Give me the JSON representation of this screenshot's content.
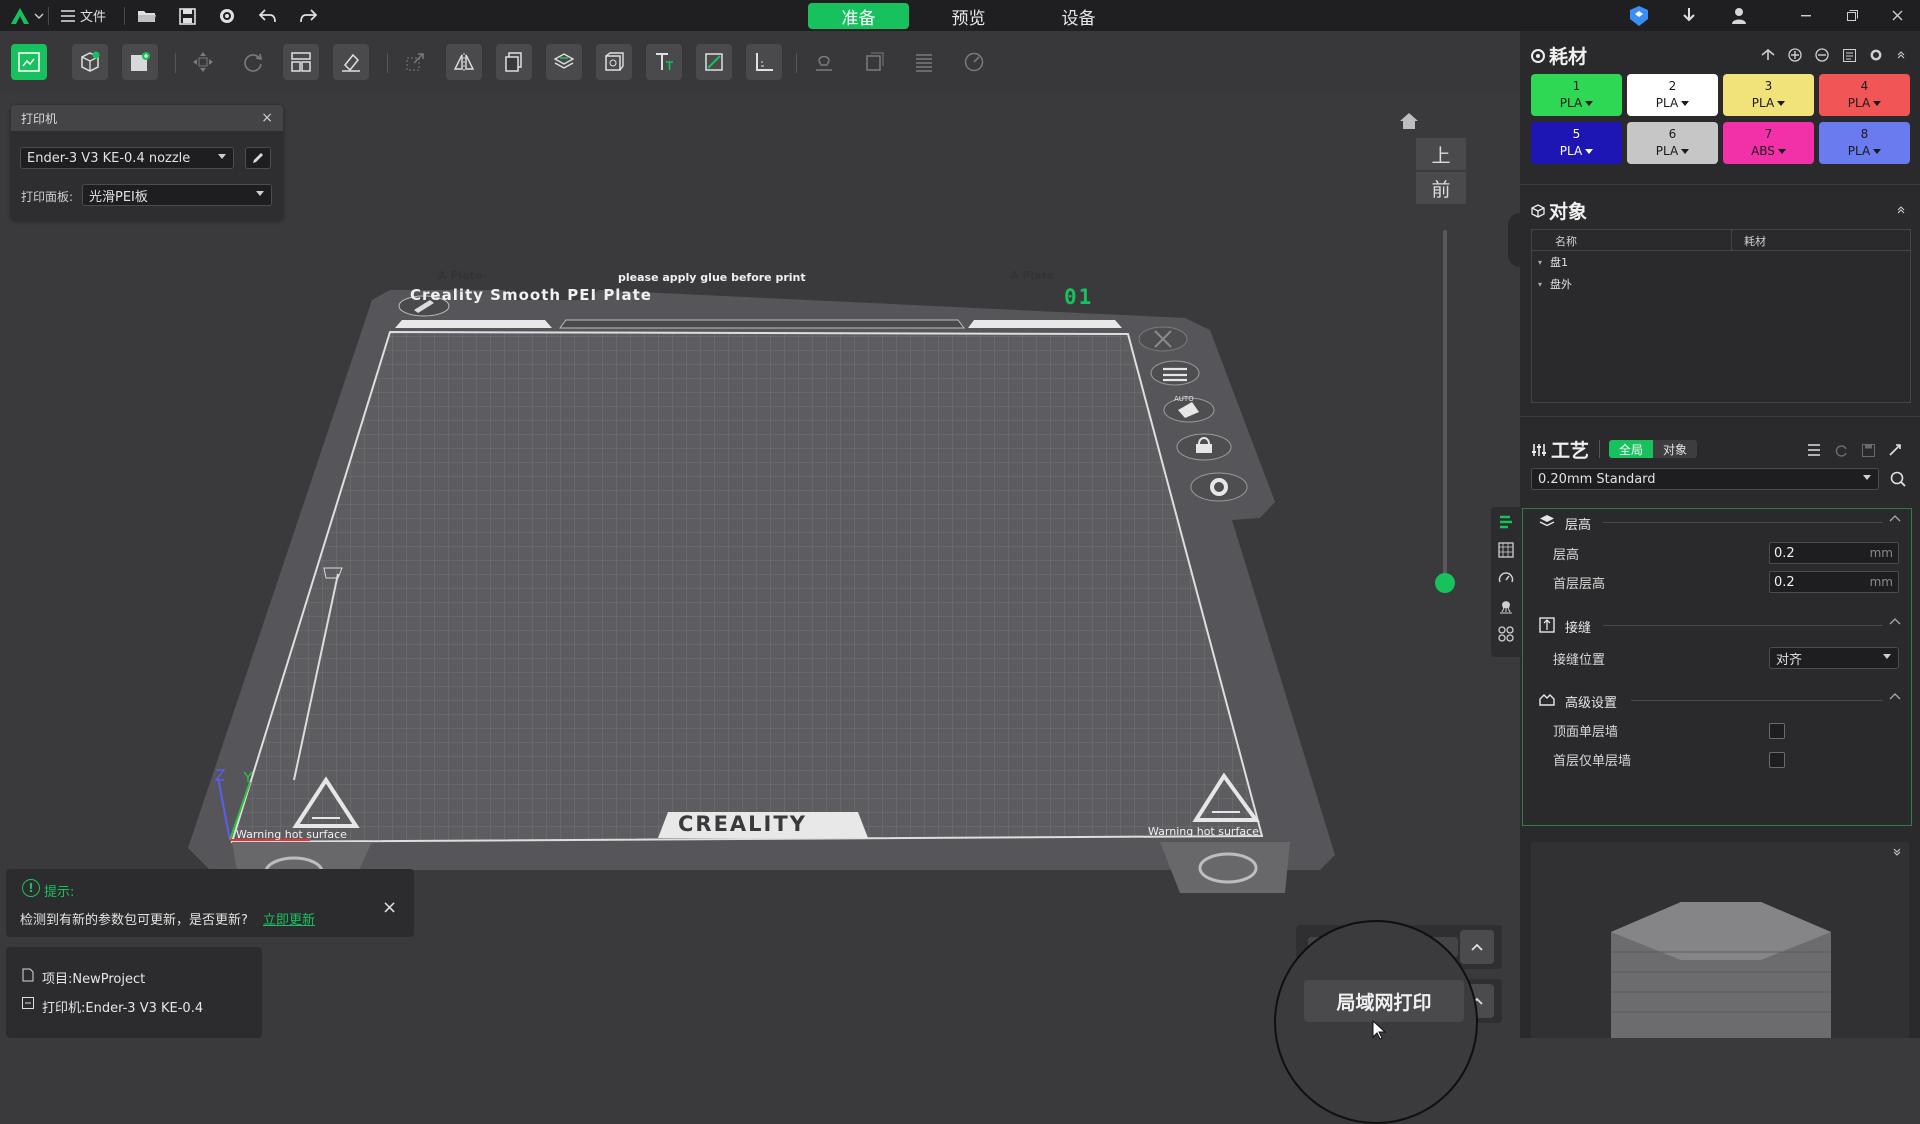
{
  "title_bar": {
    "file_label": "文件",
    "mode_tabs": [
      {
        "label": "准备",
        "active": true
      },
      {
        "label": "预览",
        "active": false
      },
      {
        "label": "设备",
        "active": false
      }
    ],
    "icons": [
      "creality-logo-icon",
      "menu-icon",
      "open-folder-icon",
      "save-icon",
      "settings-icon",
      "undo-icon",
      "redo-icon",
      "cube-badge-icon",
      "download-icon",
      "user-icon",
      "minimize-icon",
      "restore-icon",
      "close-icon"
    ]
  },
  "printer_panel": {
    "title": "打印机",
    "printer_name": "Ender-3 V3 KE-0.4 nozzle",
    "plate_label": "打印面板:",
    "plate_value": "光滑PEI板"
  },
  "plate": {
    "number": "01",
    "name_text": "Creality Smooth PEI Plate",
    "glue_text": "please apply glue before print",
    "left_tab": "A Plate",
    "right_tab": "A Plate",
    "brand": "CREALITY",
    "warning_left": "Warning hot surface",
    "warning_right": "Warning hot surface",
    "auto_label": "AUTO"
  },
  "view_controls": {
    "top_view_label": "上",
    "front_view_label": "前",
    "layer_level": 0.0
  },
  "notice": {
    "title": "提示:",
    "message": "检测到有新的参数包可更新，是否更新?",
    "link": "立即更新"
  },
  "project_info": {
    "project": "项目:NewProject",
    "printer": "打印机:Ender-3 V3 KE-0.4"
  },
  "print_actions": {
    "lan_print": "局域网打印"
  },
  "filament": {
    "title": "耗材",
    "slots": [
      {
        "num": "1",
        "type": "PLA",
        "color": "#2ed855",
        "text": "#1a1a1a"
      },
      {
        "num": "2",
        "type": "PLA",
        "color": "#ffffff",
        "text": "#1a1a1a"
      },
      {
        "num": "3",
        "type": "PLA",
        "color": "#f2e27a",
        "text": "#1a1a1a"
      },
      {
        "num": "4",
        "type": "PLA",
        "color": "#f25555",
        "text": "#1a1a1a"
      },
      {
        "num": "5",
        "type": "PLA",
        "color": "#1e16b4",
        "text": "#ffffff"
      },
      {
        "num": "6",
        "type": "PLA",
        "color": "#c6c6c6",
        "text": "#1a1a1a"
      },
      {
        "num": "7",
        "type": "ABS",
        "color": "#f230a8",
        "text": "#1a1a1a"
      },
      {
        "num": "8",
        "type": "PLA",
        "color": "#6a7bef",
        "text": "#1a1a1a"
      }
    ]
  },
  "objects": {
    "title": "对象",
    "col_name": "名称",
    "col_filament": "耗材",
    "rows": [
      "盘1",
      "盘外"
    ]
  },
  "process": {
    "title": "工艺",
    "tab_global": "全局",
    "tab_object": "对象",
    "preset": "0.20mm Standard",
    "groups": {
      "layer_height": {
        "title": "层高",
        "rows": [
          {
            "label": "层高",
            "value": "0.2",
            "unit": "mm"
          },
          {
            "label": "首层层高",
            "value": "0.2",
            "unit": "mm"
          }
        ]
      },
      "seam": {
        "title": "接缝",
        "row_label": "接缝位置",
        "row_value": "对齐"
      },
      "advanced": {
        "title": "高级设置",
        "rows": [
          {
            "label": "顶面单层墙",
            "checked": false
          },
          {
            "label": "首层仅单层墙",
            "checked": false
          }
        ]
      }
    }
  },
  "colors": {
    "accent": "#17c15e",
    "bg": "#3a3a3d",
    "panel": "#2a2a2c",
    "titlebar": "#1f1f21"
  }
}
